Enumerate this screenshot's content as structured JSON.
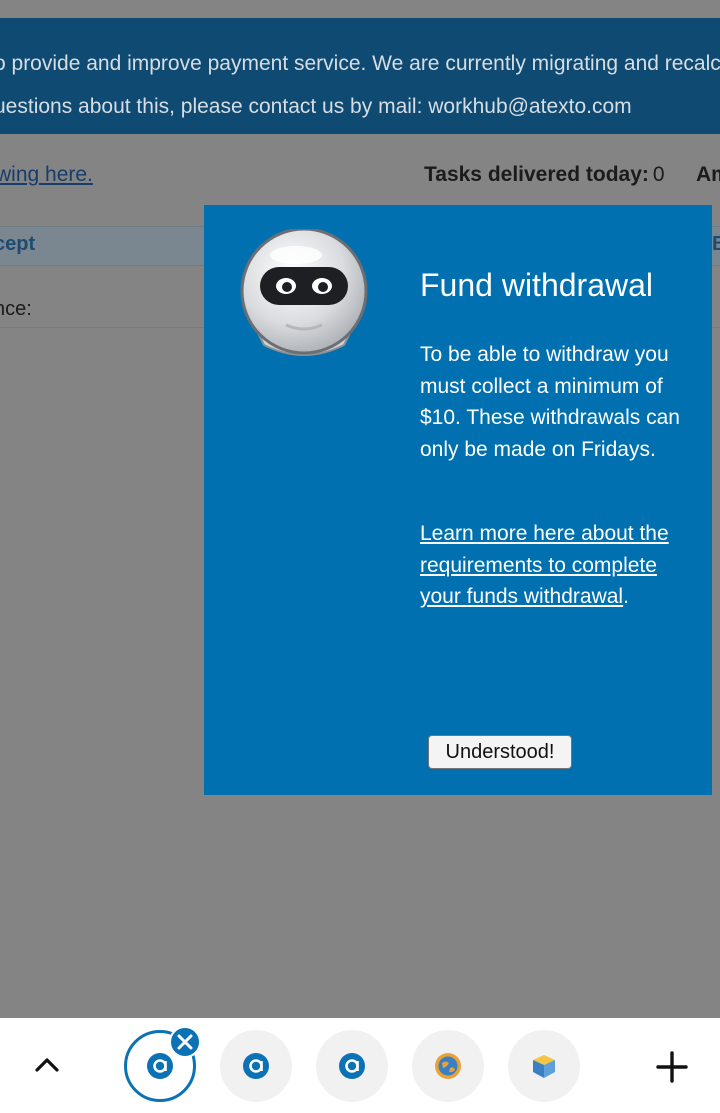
{
  "banner": {
    "line1": "o provide and improve payment service. We are currently migrating and recalc",
    "line2": "uestions about this, please contact us by mail: workhub@atexto.com"
  },
  "page": {
    "link_text": "wing here.",
    "tasks_label": "Tasks delivered today:",
    "tasks_value": "0",
    "am_label": "Am",
    "col_header": "cept",
    "col_header_b": "B",
    "balance_label": "nce:"
  },
  "modal": {
    "title": "Fund withdrawal",
    "body": "To be able to withdraw you must collect a minimum of $10. These withdrawals can only be made on Fridays.",
    "link_text": "Learn more here about the requirements to complete your funds withdrawal",
    "link_suffix": ".",
    "button": "Understood!"
  },
  "bottom_bar": {
    "tabs": [
      "atexto-tab-active",
      "atexto-tab",
      "atexto-tab",
      "globe-tab",
      "box-tab"
    ],
    "accent": "#0a72b5"
  },
  "colors": {
    "modal_bg": "#0070b0",
    "banner_bg": "#0f4a72",
    "overlay": "#848484"
  }
}
